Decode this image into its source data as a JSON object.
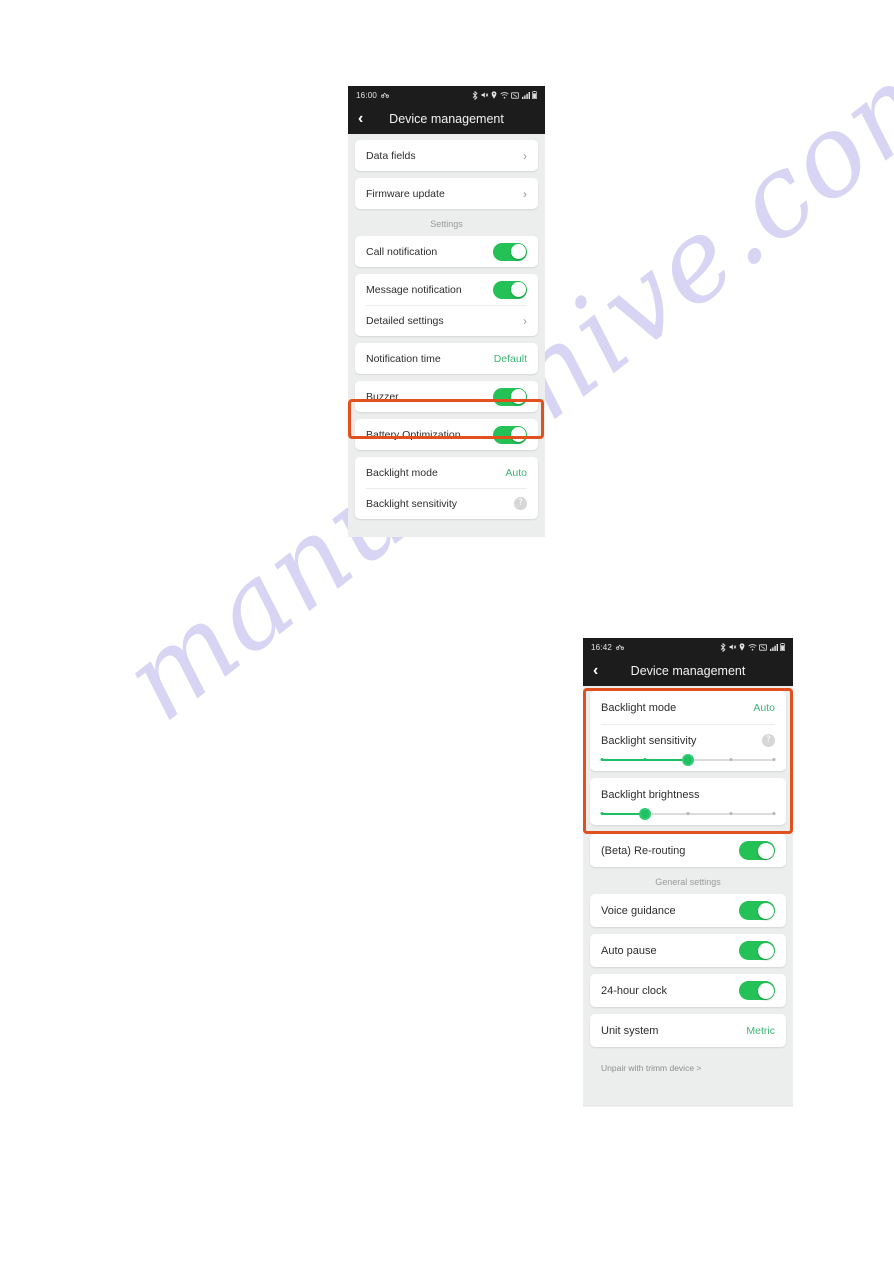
{
  "watermark": {
    "text": "manualshive.com",
    "color": "#c9c6ef"
  },
  "colors": {
    "toggle_on": "#24c157",
    "accent_green_text": "#3fb377",
    "highlight_border": "#e2501d",
    "slider_fill": "#1fbf63",
    "statusbar_bg": "#1c1c1c",
    "screen_bg": "#eceded"
  },
  "phone_one": {
    "status_bar": {
      "time": "16:00",
      "left_icons": [
        "bike-icon"
      ],
      "right_icons": [
        "bluetooth-icon",
        "mute-icon",
        "location-icon",
        "wifi-icon",
        "nfc-icon",
        "signal-icon",
        "battery-icon"
      ]
    },
    "app_bar": {
      "back_label": "‹",
      "title": "Device management"
    },
    "cards": [
      {
        "rows": [
          {
            "label": "Data fields",
            "type": "chevron"
          }
        ]
      },
      {
        "rows": [
          {
            "label": "Firmware update",
            "type": "chevron"
          }
        ]
      }
    ],
    "section_title": "Settings",
    "settings_cards": [
      {
        "rows": [
          {
            "label": "Call notification",
            "type": "toggle",
            "value": "on"
          }
        ]
      },
      {
        "rows": [
          {
            "label": "Message notification",
            "type": "toggle",
            "value": "on"
          },
          {
            "label": "Detailed settings",
            "type": "chevron"
          }
        ]
      },
      {
        "rows": [
          {
            "label": "Notification time",
            "type": "value",
            "value": "Default"
          }
        ]
      },
      {
        "rows": [
          {
            "label": "Buzzer",
            "type": "toggle",
            "value": "on"
          }
        ]
      },
      {
        "rows": [
          {
            "label": "Battery Optimization",
            "type": "toggle",
            "value": "on"
          }
        ]
      },
      {
        "rows": [
          {
            "label": "Backlight mode",
            "type": "value",
            "value": "Auto"
          },
          {
            "label": "Backlight sensitivity",
            "type": "help"
          }
        ]
      }
    ],
    "highlight": "Buzzer"
  },
  "phone_two": {
    "status_bar": {
      "time": "16:42",
      "left_icons": [
        "bike-icon"
      ],
      "right_icons": [
        "bluetooth-icon",
        "mute-icon",
        "location-icon",
        "wifi-icon",
        "nfc-icon",
        "signal-icon",
        "battery-icon"
      ]
    },
    "app_bar": {
      "back_label": "‹",
      "title": "Device management"
    },
    "backlight_card": {
      "rows": [
        {
          "label": "Backlight mode",
          "type": "value",
          "value": "Auto"
        },
        {
          "label": "Backlight sensitivity",
          "type": "help"
        }
      ],
      "sensitivity_slider": {
        "ticks": 5,
        "position": 3,
        "percent": 50
      }
    },
    "brightness_card": {
      "label": "Backlight brightness",
      "slider": {
        "ticks": 5,
        "position": 2,
        "percent": 25
      }
    },
    "rerouting_card": {
      "rows": [
        {
          "label": "(Beta) Re-routing",
          "type": "toggle",
          "value": "on"
        }
      ]
    },
    "section_title": "General settings",
    "general_cards": [
      {
        "rows": [
          {
            "label": "Voice guidance",
            "type": "toggle",
            "value": "on"
          }
        ]
      },
      {
        "rows": [
          {
            "label": "Auto pause",
            "type": "toggle",
            "value": "on"
          }
        ]
      },
      {
        "rows": [
          {
            "label": "24-hour clock",
            "type": "toggle",
            "value": "on"
          }
        ]
      },
      {
        "rows": [
          {
            "label": "Unit system",
            "type": "value",
            "value": "Metric"
          }
        ]
      }
    ],
    "footer_link": "Unpair with trimm device >",
    "highlight": "Backlight settings group"
  }
}
